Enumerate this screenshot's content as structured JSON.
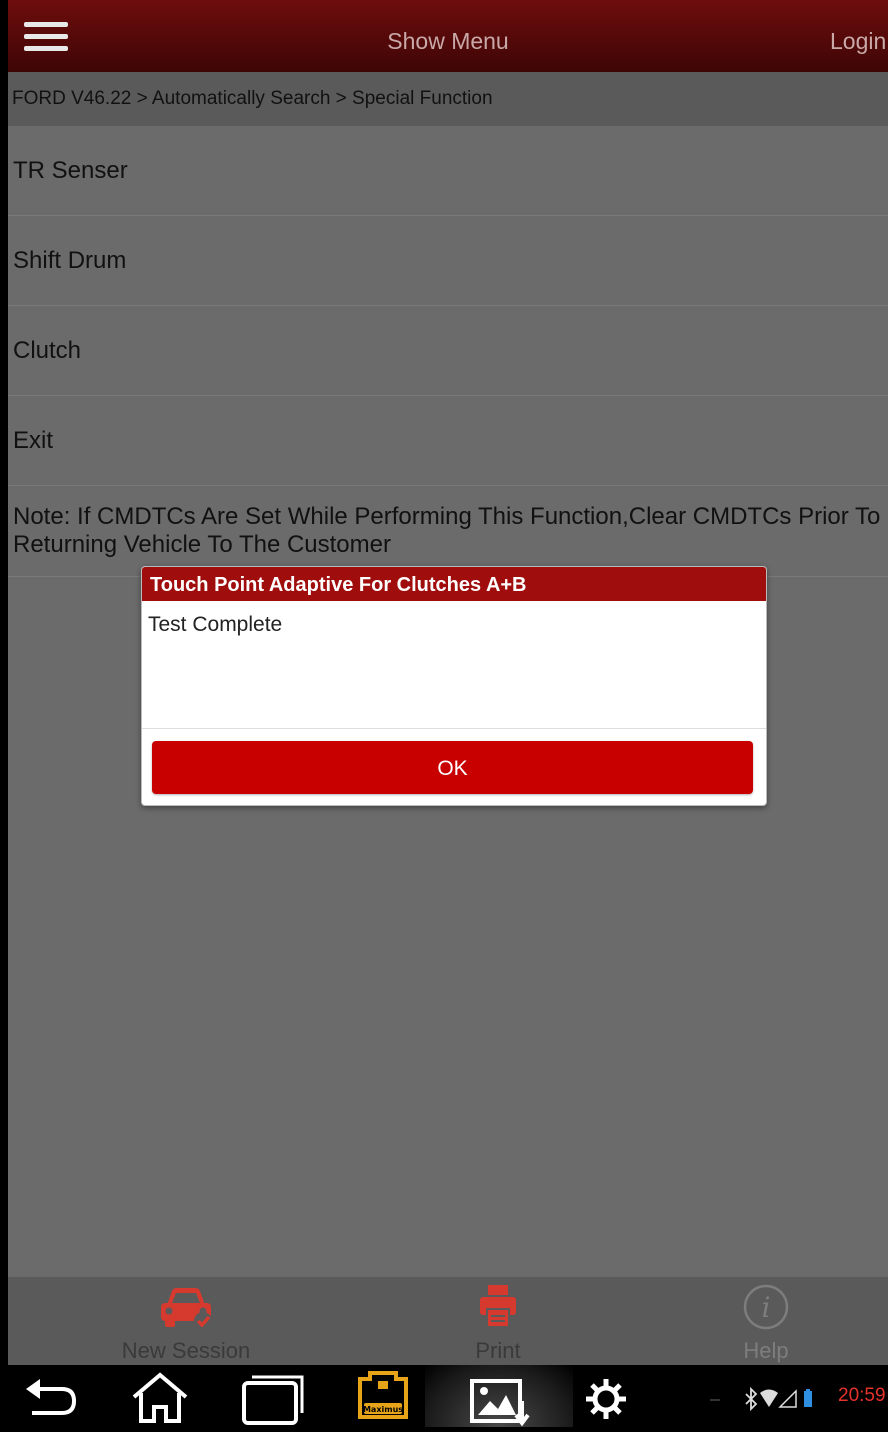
{
  "topbar": {
    "title": "Show Menu",
    "login": "Login"
  },
  "breadcrumb": "FORD V46.22 > Automatically Search > Special Function",
  "menu_items": [
    "TR Senser",
    "Shift Drum",
    "Clutch",
    "Exit"
  ],
  "note": "Note: If CMDTCs Are Set While Performing This Function,Clear CMDTCs Prior To Returning Vehicle To The Customer",
  "dialog": {
    "title": "Touch Point Adaptive For Clutches A+B",
    "message": "Test Complete",
    "ok_label": "OK"
  },
  "toolbar": {
    "new_session": "New Session",
    "print": "Print",
    "help": "Help"
  },
  "status_bar": {
    "time": "20:59"
  },
  "colors": {
    "brand_red": "#c80000",
    "dialog_title": "#a00d0d",
    "clock": "#e5322b"
  },
  "icons": [
    "menu-icon",
    "car-check-icon",
    "printer-icon",
    "info-icon",
    "back-icon",
    "home-icon",
    "recent-apps-icon",
    "maximus-icon",
    "screenshot-icon",
    "settings-icon",
    "bluetooth-icon",
    "wifi-icon",
    "signal-icon",
    "battery-icon"
  ]
}
